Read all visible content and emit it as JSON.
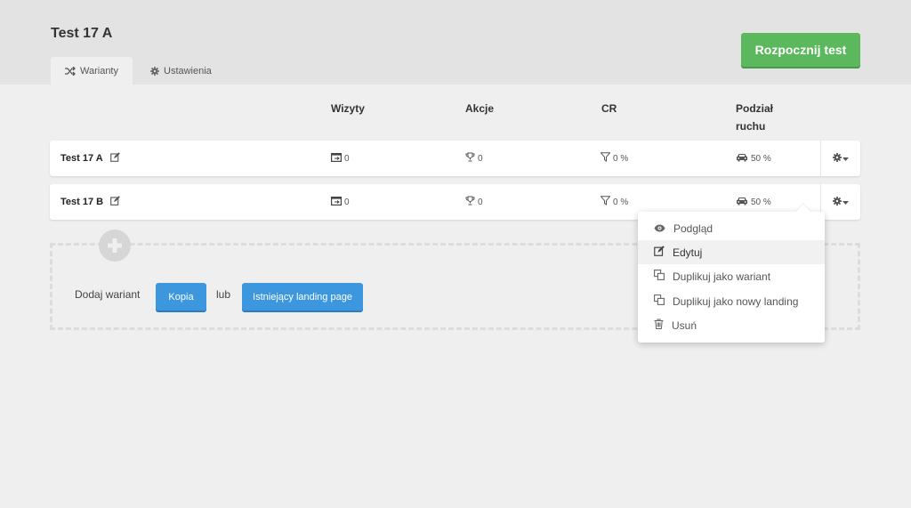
{
  "header": {
    "title": "Test 17 A",
    "start_button": "Rozpocznij test",
    "tabs": [
      {
        "label": "Warianty",
        "icon": "shuffle-icon",
        "active": true
      },
      {
        "label": "Ustawienia",
        "icon": "gear-icon",
        "active": false
      }
    ]
  },
  "table": {
    "columns": {
      "visits": "Wizyty",
      "actions": "Akcje",
      "cr": "CR",
      "traffic_line1": "Podział",
      "traffic_line2": "ruchu"
    },
    "rows": [
      {
        "name": "Test 17 A",
        "visits": "0",
        "actions": "0",
        "cr": "0 %",
        "traffic": "50 %"
      },
      {
        "name": "Test 17 B",
        "visits": "0",
        "actions": "0",
        "cr": "0 %",
        "traffic": "50 %"
      }
    ]
  },
  "add_variant": {
    "label": "Dodaj wariant",
    "copy_button": "Kopia",
    "or": "lub",
    "existing_button": "Istniejący landing page"
  },
  "dropdown": {
    "items": [
      {
        "label": "Podgląd",
        "icon": "eye-icon"
      },
      {
        "label": "Edytuj",
        "icon": "edit-icon"
      },
      {
        "label": "Duplikuj jako wariant",
        "icon": "copy-icon"
      },
      {
        "label": "Duplikuj jako nowy landing",
        "icon": "copy-icon"
      },
      {
        "label": "Usuń",
        "icon": "trash-icon"
      }
    ]
  },
  "colors": {
    "start_button": "#5cb85c",
    "primary_button": "#3d97de",
    "header_bg": "#e3e3e3",
    "page_bg": "#efefef"
  }
}
